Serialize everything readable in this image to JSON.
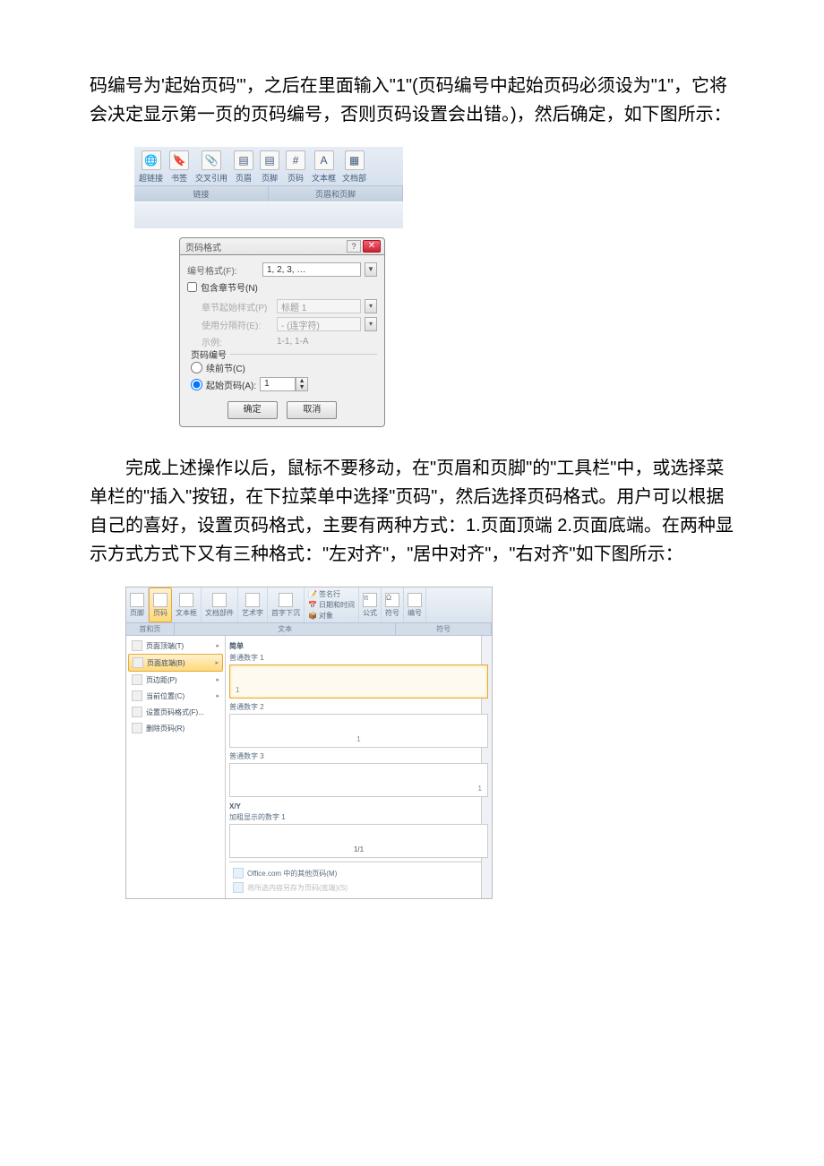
{
  "para1": "码编号为'起始页码'\"，之后在里面输入\"1\"(页码编号中起始页码必须设为\"1\"，它将会决定显示第一页的页码编号，否则页码设置会出错。)，然后确定，如下图所示：",
  "para2": "完成上述操作以后，鼠标不要移动，在\"页眉和页脚\"的\"工具栏\"中，或选择菜单栏的\"插入\"按钮，在下拉菜单中选择\"页码\"，然后选择页码格式。用户可以根据自己的喜好，设置页码格式，主要有两种方式：1.页面顶端 2.页面底端。在两种显示方式方式下又有三种格式：\"左对齐\"，\"居中对齐\"，\"右对齐\"如下图所示：",
  "ribbon1": {
    "btns": [
      "超链接",
      "书签",
      "交叉引用",
      "页眉",
      "页脚",
      "页码",
      "文本框",
      "文档部"
    ],
    "groups": [
      "链接",
      "页眉和页脚"
    ]
  },
  "dialog": {
    "title": "页码格式",
    "fmt_label": "编号格式(F):",
    "fmt_value": "1, 2, 3, …",
    "chk_label": "包含章节号(N)",
    "chap_label": "章节起始样式(P)",
    "chap_value": "标题 1",
    "sep_label": "使用分隔符(E):",
    "sep_value": "- (连字符)",
    "ex_label": "示例:",
    "ex_value": "1-1, 1-A",
    "grp": "页码编号",
    "r1": "续前节(C)",
    "r2": "起始页码(A):",
    "start_val": "1",
    "ok": "确定",
    "cancel": "取消"
  },
  "ribbon2": {
    "cols": [
      "页脚",
      "页码",
      "文本框",
      "文档部件",
      "艺术字",
      "首字下沉"
    ],
    "extra": [
      "签名行",
      "日期和时间",
      "对象"
    ],
    "sym": [
      "公式",
      "符号",
      "编号"
    ],
    "groups": [
      "",
      "文本",
      "符号"
    ],
    "tab": "首和页"
  },
  "menu": {
    "items": [
      {
        "t": "页面顶端(T)",
        "arrow": true
      },
      {
        "t": "页面底端(B)",
        "hl": true,
        "arrow": true
      },
      {
        "t": "页边距(P)",
        "arrow": true
      },
      {
        "t": "当前位置(C)",
        "arrow": true
      },
      {
        "t": "设置页码格式(F)..."
      },
      {
        "t": "删除页码(R)"
      }
    ]
  },
  "gallery": {
    "sec0": "简单",
    "s1": "普通数字 1",
    "s2": "普通数字 2",
    "s3": "普通数字 3",
    "xy": "X/Y",
    "s4": "加粗显示的数字 1",
    "num": "1",
    "foot1": "Office.com 中的其他页码(M)",
    "foot2": "将所选内容另存为页码(底端)(S)"
  }
}
